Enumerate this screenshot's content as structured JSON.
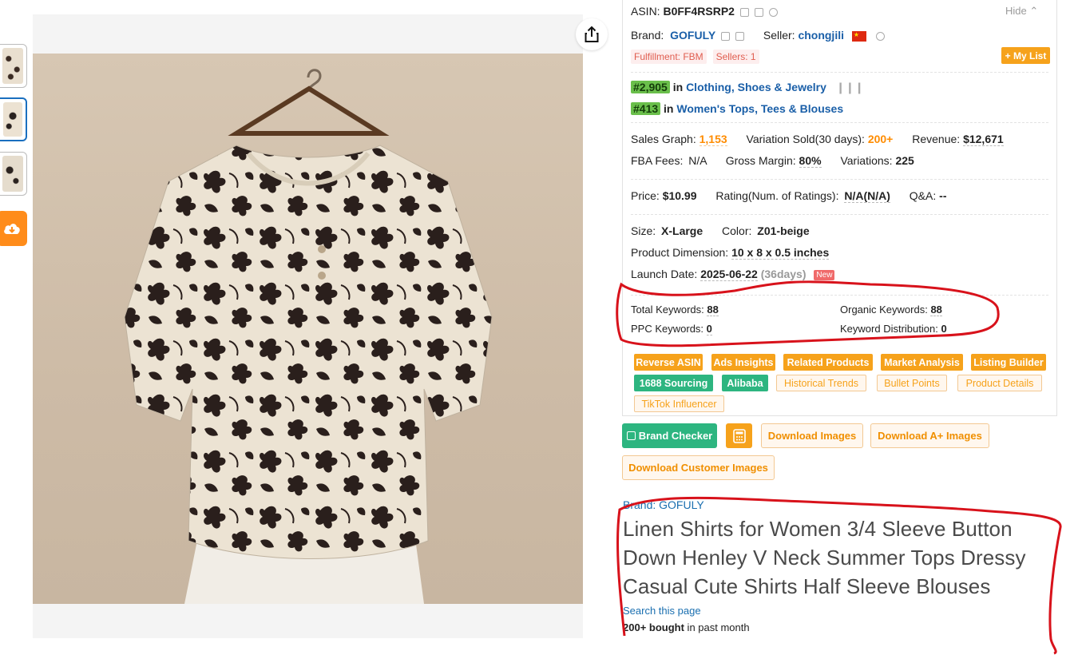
{
  "product_meta": {
    "asin_label": "ASIN:",
    "asin": "B0FF4RSRP2",
    "hide_label": "Hide",
    "brand_label": "Brand:",
    "brand": "GOFULY",
    "seller_label": "Seller:",
    "seller": "chongjili",
    "fulfillment_tag": "Fulfillment: FBM",
    "sellers_tag": "Sellers: 1",
    "mylist_button": "+ My List"
  },
  "ranks": [
    {
      "rank": "#2,905",
      "in": "in",
      "category": "Clothing, Shoes & Jewelry"
    },
    {
      "rank": "#413",
      "in": "in",
      "category": "Women's Tops, Tees & Blouses"
    }
  ],
  "sales": {
    "sales_graph_label": "Sales Graph:",
    "sales_graph_value": "1,153",
    "variation_sold_label": "Variation Sold(30 days):",
    "variation_sold_value": "200+",
    "revenue_label": "Revenue:",
    "revenue_value": "$12,671",
    "fba_fees_label": "FBA Fees:",
    "fba_fees_value": "N/A",
    "gross_margin_label": "Gross Margin:",
    "gross_margin_value": "80%",
    "variations_label": "Variations:",
    "variations_value": "225"
  },
  "pricing": {
    "price_label": "Price:",
    "price_value": "$10.99",
    "rating_label": "Rating(Num. of Ratings):",
    "rating_value": "N/A(N/A)",
    "qa_label": "Q&A:",
    "qa_value": "--"
  },
  "details": {
    "size_label": "Size:",
    "size_value": "X-Large",
    "color_label": "Color:",
    "color_value": "Z01-beige",
    "dimension_label": "Product Dimension:",
    "dimension_value": "10 x 8 x 0.5 inches",
    "launch_label": "Launch Date:",
    "launch_value": "2025-06-22",
    "launch_days": "(36days)",
    "new_badge": "New"
  },
  "keywords": {
    "total_label": "Total Keywords:",
    "total_value": "88",
    "organic_label": "Organic Keywords:",
    "organic_value": "88",
    "ppc_label": "PPC Keywords:",
    "ppc_value": "0",
    "distribution_label": "Keyword Distribution:",
    "distribution_value": "0"
  },
  "tool_buttons": {
    "reverse_asin": "Reverse ASIN",
    "ads_insights": "Ads Insights",
    "related_products": "Related Products",
    "market_analysis": "Market Analysis",
    "listing_builder": "Listing Builder",
    "sourcing_1688": "1688 Sourcing",
    "alibaba": "Alibaba",
    "historical_trends": "Historical Trends",
    "bullet_points": "Bullet Points",
    "product_details": "Product Details",
    "tiktok_influencer": "TikTok Influencer"
  },
  "action_buttons": {
    "brand_checker": "Brand Checker",
    "download_images": "Download Images",
    "download_aplus_images": "Download A+ Images",
    "download_customer_images": "Download Customer Images"
  },
  "listing": {
    "brand_link": "Brand: GOFULY",
    "title": "Linen Shirts for Women 3/4 Sleeve Button Down Henley V Neck Summer Tops Dressy Casual Cute Shirts Half Sleeve Blouses",
    "search_page": "Search this page",
    "bought_bold": "200+ bought",
    "bought_rest": " in past month"
  },
  "colors": {
    "accent_orange": "#f6a21b",
    "accent_green": "#2db580",
    "link_blue": "#1a5fa8",
    "annotation_red": "#d8121b",
    "rank_green": "#6abf4b"
  }
}
